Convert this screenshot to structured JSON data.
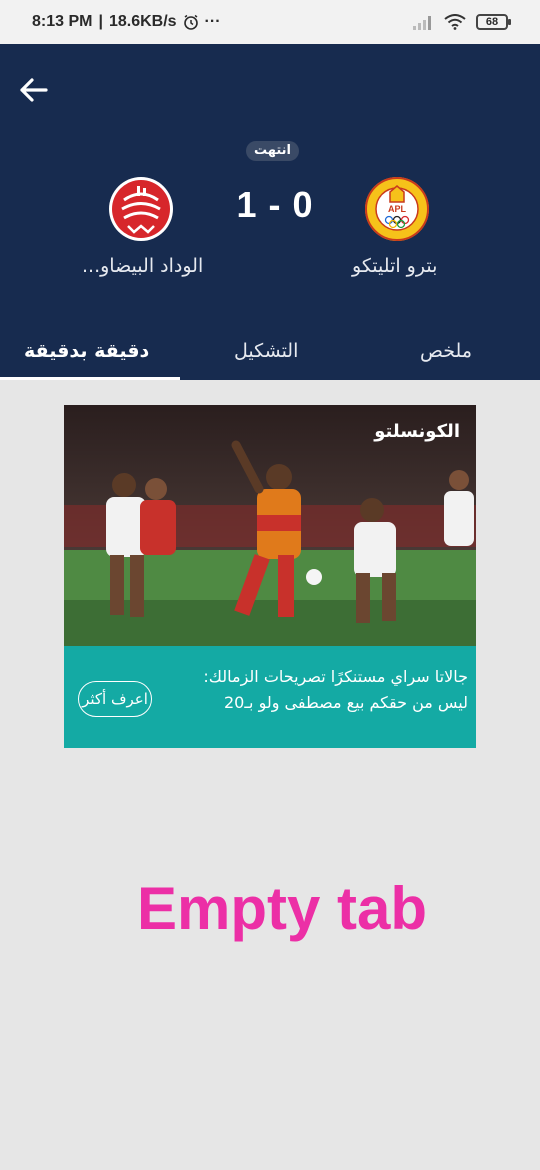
{
  "status_bar": {
    "time": "8:13 PM",
    "separator": "|",
    "speed": "18.6KB/s",
    "more": "···",
    "battery": "68"
  },
  "header": {
    "match_status": "انتهت",
    "score": "1 - 0",
    "home_team": "بترو اتليتكو",
    "away_team": "الوداد البيضاو...",
    "colors": {
      "background": "#172b4f",
      "home_logo": "#f6c21a",
      "away_logo": "#d7262b"
    }
  },
  "tabs": [
    {
      "label": "ملخص"
    },
    {
      "label": "التشكيل"
    },
    {
      "label": "دقيقة بدقيقة",
      "active": true
    }
  ],
  "ad": {
    "brand": "الكونسلتو",
    "text_line1": "جالاتا سراي مستنكرًا تصريحات الزمالك:",
    "text_line2": "ليس من حقكم بيع مصطفى ولو بـ20",
    "cta": "اعرف أكثر",
    "color": "#14aaa4"
  },
  "overlay": "Empty tab"
}
